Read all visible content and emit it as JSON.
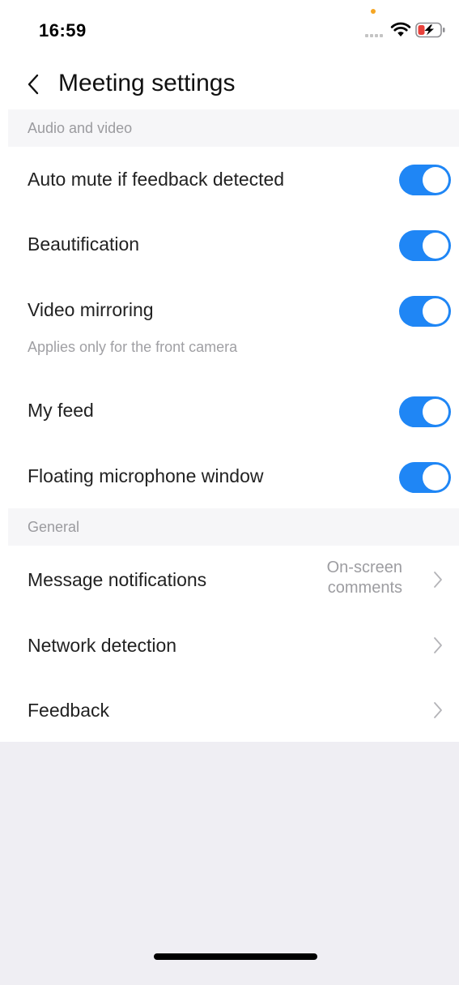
{
  "status_bar": {
    "time": "16:59"
  },
  "header": {
    "title": "Meeting settings"
  },
  "sections": {
    "audio_video": {
      "title": "Audio and video",
      "items": [
        {
          "label": "Auto mute if feedback detected",
          "toggle": true
        },
        {
          "label": "Beautification",
          "toggle": true
        },
        {
          "label": "Video mirroring",
          "subtitle": "Applies only for the front camera",
          "toggle": true
        },
        {
          "label": "My feed",
          "toggle": true
        },
        {
          "label": "Floating microphone window",
          "toggle": true
        }
      ]
    },
    "general": {
      "title": "General",
      "items": [
        {
          "label": "Message notifications",
          "value_line1": "On-screen",
          "value_line2": "comments"
        },
        {
          "label": "Network detection"
        },
        {
          "label": "Feedback"
        }
      ]
    }
  },
  "colors": {
    "toggle_on": "#1f86f5",
    "section_bg": "#f6f6f8",
    "page_bg": "#efeef3",
    "battery_red": "#e8413b"
  },
  "icons": [
    "back-chevron-icon",
    "wifi-icon",
    "battery-charging-icon",
    "cell-signal-icon",
    "chevron-right-icon"
  ]
}
